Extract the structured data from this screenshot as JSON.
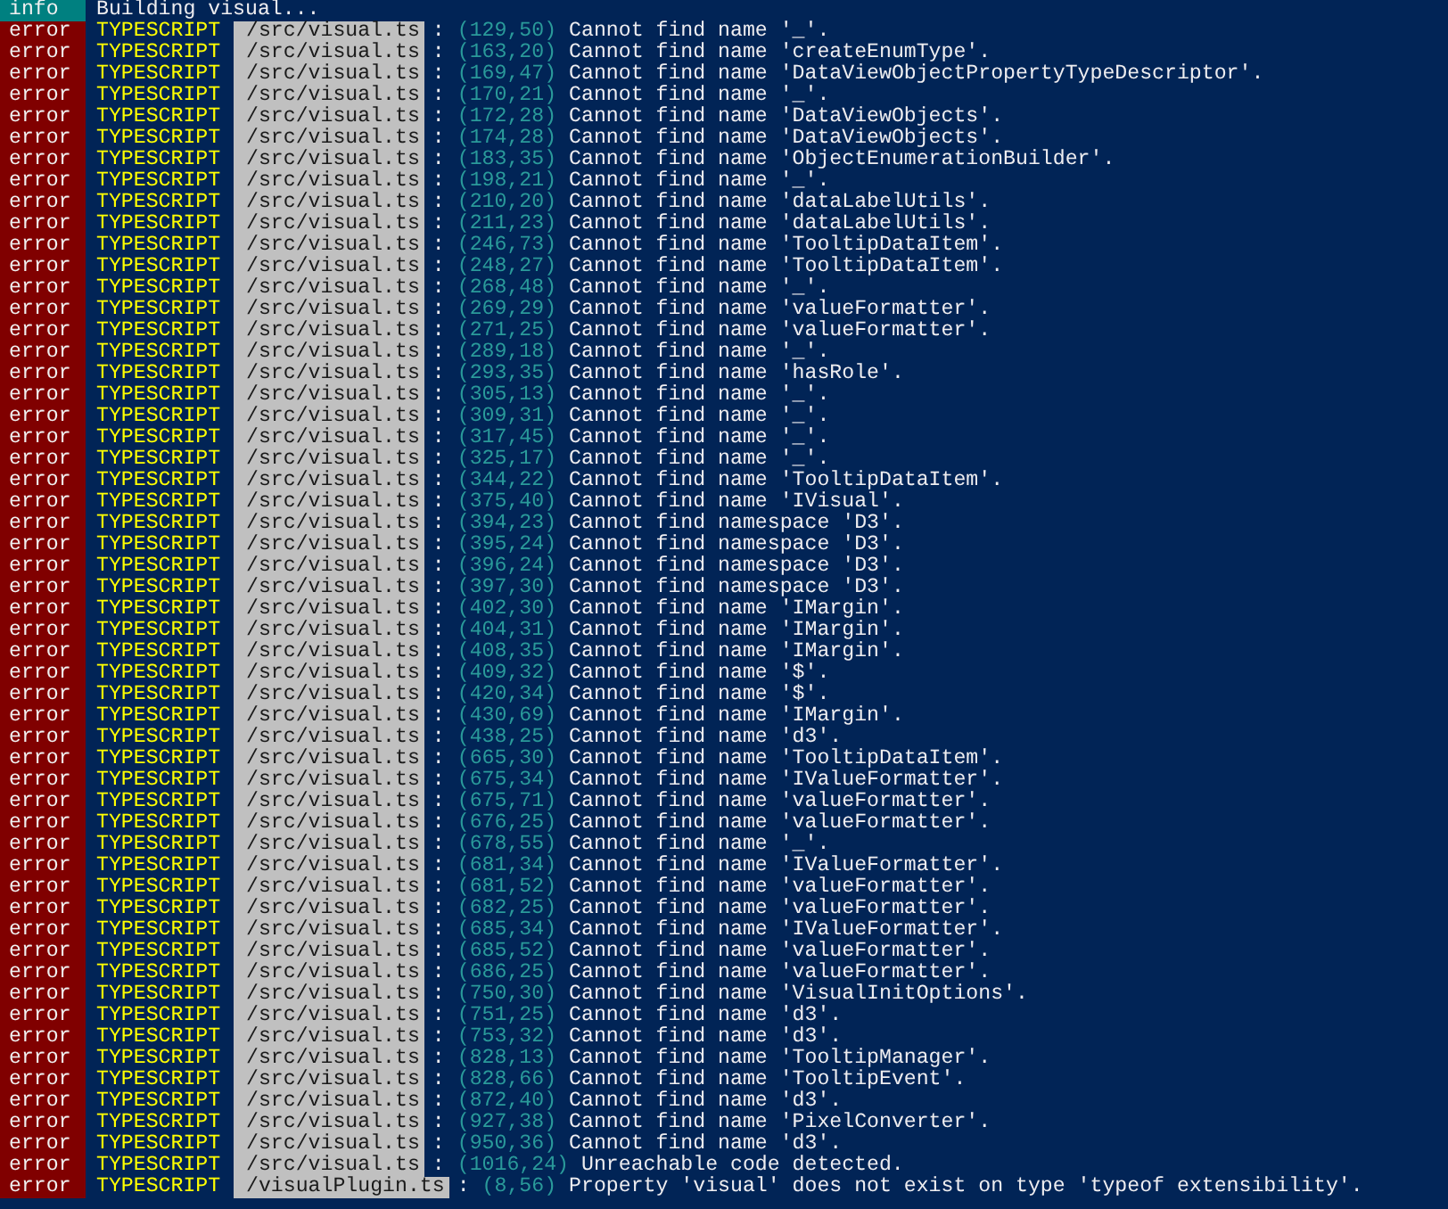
{
  "lines": [
    {
      "severity": "info",
      "message": "Building visual..."
    },
    {
      "severity": "error",
      "source": "TYPESCRIPT",
      "file": "/src/visual.ts",
      "separator": ":",
      "location": "(129,50)",
      "message": "Cannot find name '_'."
    },
    {
      "severity": "error",
      "source": "TYPESCRIPT",
      "file": "/src/visual.ts",
      "separator": ":",
      "location": "(163,20)",
      "message": "Cannot find name 'createEnumType'."
    },
    {
      "severity": "error",
      "source": "TYPESCRIPT",
      "file": "/src/visual.ts",
      "separator": ":",
      "location": "(169,47)",
      "message": "Cannot find name 'DataViewObjectPropertyTypeDescriptor'."
    },
    {
      "severity": "error",
      "source": "TYPESCRIPT",
      "file": "/src/visual.ts",
      "separator": ":",
      "location": "(170,21)",
      "message": "Cannot find name '_'."
    },
    {
      "severity": "error",
      "source": "TYPESCRIPT",
      "file": "/src/visual.ts",
      "separator": ":",
      "location": "(172,28)",
      "message": "Cannot find name 'DataViewObjects'."
    },
    {
      "severity": "error",
      "source": "TYPESCRIPT",
      "file": "/src/visual.ts",
      "separator": ":",
      "location": "(174,28)",
      "message": "Cannot find name 'DataViewObjects'."
    },
    {
      "severity": "error",
      "source": "TYPESCRIPT",
      "file": "/src/visual.ts",
      "separator": ":",
      "location": "(183,35)",
      "message": "Cannot find name 'ObjectEnumerationBuilder'."
    },
    {
      "severity": "error",
      "source": "TYPESCRIPT",
      "file": "/src/visual.ts",
      "separator": ":",
      "location": "(198,21)",
      "message": "Cannot find name '_'."
    },
    {
      "severity": "error",
      "source": "TYPESCRIPT",
      "file": "/src/visual.ts",
      "separator": ":",
      "location": "(210,20)",
      "message": "Cannot find name 'dataLabelUtils'."
    },
    {
      "severity": "error",
      "source": "TYPESCRIPT",
      "file": "/src/visual.ts",
      "separator": ":",
      "location": "(211,23)",
      "message": "Cannot find name 'dataLabelUtils'."
    },
    {
      "severity": "error",
      "source": "TYPESCRIPT",
      "file": "/src/visual.ts",
      "separator": ":",
      "location": "(246,73)",
      "message": "Cannot find name 'TooltipDataItem'."
    },
    {
      "severity": "error",
      "source": "TYPESCRIPT",
      "file": "/src/visual.ts",
      "separator": ":",
      "location": "(248,27)",
      "message": "Cannot find name 'TooltipDataItem'."
    },
    {
      "severity": "error",
      "source": "TYPESCRIPT",
      "file": "/src/visual.ts",
      "separator": ":",
      "location": "(268,48)",
      "message": "Cannot find name '_'."
    },
    {
      "severity": "error",
      "source": "TYPESCRIPT",
      "file": "/src/visual.ts",
      "separator": ":",
      "location": "(269,29)",
      "message": "Cannot find name 'valueFormatter'."
    },
    {
      "severity": "error",
      "source": "TYPESCRIPT",
      "file": "/src/visual.ts",
      "separator": ":",
      "location": "(271,25)",
      "message": "Cannot find name 'valueFormatter'."
    },
    {
      "severity": "error",
      "source": "TYPESCRIPT",
      "file": "/src/visual.ts",
      "separator": ":",
      "location": "(289,18)",
      "message": "Cannot find name '_'."
    },
    {
      "severity": "error",
      "source": "TYPESCRIPT",
      "file": "/src/visual.ts",
      "separator": ":",
      "location": "(293,35)",
      "message": "Cannot find name 'hasRole'."
    },
    {
      "severity": "error",
      "source": "TYPESCRIPT",
      "file": "/src/visual.ts",
      "separator": ":",
      "location": "(305,13)",
      "message": "Cannot find name '_'."
    },
    {
      "severity": "error",
      "source": "TYPESCRIPT",
      "file": "/src/visual.ts",
      "separator": ":",
      "location": "(309,31)",
      "message": "Cannot find name '_'."
    },
    {
      "severity": "error",
      "source": "TYPESCRIPT",
      "file": "/src/visual.ts",
      "separator": ":",
      "location": "(317,45)",
      "message": "Cannot find name '_'."
    },
    {
      "severity": "error",
      "source": "TYPESCRIPT",
      "file": "/src/visual.ts",
      "separator": ":",
      "location": "(325,17)",
      "message": "Cannot find name '_'."
    },
    {
      "severity": "error",
      "source": "TYPESCRIPT",
      "file": "/src/visual.ts",
      "separator": ":",
      "location": "(344,22)",
      "message": "Cannot find name 'TooltipDataItem'."
    },
    {
      "severity": "error",
      "source": "TYPESCRIPT",
      "file": "/src/visual.ts",
      "separator": ":",
      "location": "(375,40)",
      "message": "Cannot find name 'IVisual'."
    },
    {
      "severity": "error",
      "source": "TYPESCRIPT",
      "file": "/src/visual.ts",
      "separator": ":",
      "location": "(394,23)",
      "message": "Cannot find namespace 'D3'."
    },
    {
      "severity": "error",
      "source": "TYPESCRIPT",
      "file": "/src/visual.ts",
      "separator": ":",
      "location": "(395,24)",
      "message": "Cannot find namespace 'D3'."
    },
    {
      "severity": "error",
      "source": "TYPESCRIPT",
      "file": "/src/visual.ts",
      "separator": ":",
      "location": "(396,24)",
      "message": "Cannot find namespace 'D3'."
    },
    {
      "severity": "error",
      "source": "TYPESCRIPT",
      "file": "/src/visual.ts",
      "separator": ":",
      "location": "(397,30)",
      "message": "Cannot find namespace 'D3'."
    },
    {
      "severity": "error",
      "source": "TYPESCRIPT",
      "file": "/src/visual.ts",
      "separator": ":",
      "location": "(402,30)",
      "message": "Cannot find name 'IMargin'."
    },
    {
      "severity": "error",
      "source": "TYPESCRIPT",
      "file": "/src/visual.ts",
      "separator": ":",
      "location": "(404,31)",
      "message": "Cannot find name 'IMargin'."
    },
    {
      "severity": "error",
      "source": "TYPESCRIPT",
      "file": "/src/visual.ts",
      "separator": ":",
      "location": "(408,35)",
      "message": "Cannot find name 'IMargin'."
    },
    {
      "severity": "error",
      "source": "TYPESCRIPT",
      "file": "/src/visual.ts",
      "separator": ":",
      "location": "(409,32)",
      "message": "Cannot find name '$'."
    },
    {
      "severity": "error",
      "source": "TYPESCRIPT",
      "file": "/src/visual.ts",
      "separator": ":",
      "location": "(420,34)",
      "message": "Cannot find name '$'."
    },
    {
      "severity": "error",
      "source": "TYPESCRIPT",
      "file": "/src/visual.ts",
      "separator": ":",
      "location": "(430,69)",
      "message": "Cannot find name 'IMargin'."
    },
    {
      "severity": "error",
      "source": "TYPESCRIPT",
      "file": "/src/visual.ts",
      "separator": ":",
      "location": "(438,25)",
      "message": "Cannot find name 'd3'."
    },
    {
      "severity": "error",
      "source": "TYPESCRIPT",
      "file": "/src/visual.ts",
      "separator": ":",
      "location": "(665,30)",
      "message": "Cannot find name 'TooltipDataItem'."
    },
    {
      "severity": "error",
      "source": "TYPESCRIPT",
      "file": "/src/visual.ts",
      "separator": ":",
      "location": "(675,34)",
      "message": "Cannot find name 'IValueFormatter'."
    },
    {
      "severity": "error",
      "source": "TYPESCRIPT",
      "file": "/src/visual.ts",
      "separator": ":",
      "location": "(675,71)",
      "message": "Cannot find name 'valueFormatter'."
    },
    {
      "severity": "error",
      "source": "TYPESCRIPT",
      "file": "/src/visual.ts",
      "separator": ":",
      "location": "(676,25)",
      "message": "Cannot find name 'valueFormatter'."
    },
    {
      "severity": "error",
      "source": "TYPESCRIPT",
      "file": "/src/visual.ts",
      "separator": ":",
      "location": "(678,55)",
      "message": "Cannot find name '_'."
    },
    {
      "severity": "error",
      "source": "TYPESCRIPT",
      "file": "/src/visual.ts",
      "separator": ":",
      "location": "(681,34)",
      "message": "Cannot find name 'IValueFormatter'."
    },
    {
      "severity": "error",
      "source": "TYPESCRIPT",
      "file": "/src/visual.ts",
      "separator": ":",
      "location": "(681,52)",
      "message": "Cannot find name 'valueFormatter'."
    },
    {
      "severity": "error",
      "source": "TYPESCRIPT",
      "file": "/src/visual.ts",
      "separator": ":",
      "location": "(682,25)",
      "message": "Cannot find name 'valueFormatter'."
    },
    {
      "severity": "error",
      "source": "TYPESCRIPT",
      "file": "/src/visual.ts",
      "separator": ":",
      "location": "(685,34)",
      "message": "Cannot find name 'IValueFormatter'."
    },
    {
      "severity": "error",
      "source": "TYPESCRIPT",
      "file": "/src/visual.ts",
      "separator": ":",
      "location": "(685,52)",
      "message": "Cannot find name 'valueFormatter'."
    },
    {
      "severity": "error",
      "source": "TYPESCRIPT",
      "file": "/src/visual.ts",
      "separator": ":",
      "location": "(686,25)",
      "message": "Cannot find name 'valueFormatter'."
    },
    {
      "severity": "error",
      "source": "TYPESCRIPT",
      "file": "/src/visual.ts",
      "separator": ":",
      "location": "(750,30)",
      "message": "Cannot find name 'VisualInitOptions'."
    },
    {
      "severity": "error",
      "source": "TYPESCRIPT",
      "file": "/src/visual.ts",
      "separator": ":",
      "location": "(751,25)",
      "message": "Cannot find name 'd3'."
    },
    {
      "severity": "error",
      "source": "TYPESCRIPT",
      "file": "/src/visual.ts",
      "separator": ":",
      "location": "(753,32)",
      "message": "Cannot find name 'd3'."
    },
    {
      "severity": "error",
      "source": "TYPESCRIPT",
      "file": "/src/visual.ts",
      "separator": ":",
      "location": "(828,13)",
      "message": "Cannot find name 'TooltipManager'."
    },
    {
      "severity": "error",
      "source": "TYPESCRIPT",
      "file": "/src/visual.ts",
      "separator": ":",
      "location": "(828,66)",
      "message": "Cannot find name 'TooltipEvent'."
    },
    {
      "severity": "error",
      "source": "TYPESCRIPT",
      "file": "/src/visual.ts",
      "separator": ":",
      "location": "(872,40)",
      "message": "Cannot find name 'd3'."
    },
    {
      "severity": "error",
      "source": "TYPESCRIPT",
      "file": "/src/visual.ts",
      "separator": ":",
      "location": "(927,38)",
      "message": "Cannot find name 'PixelConverter'."
    },
    {
      "severity": "error",
      "source": "TYPESCRIPT",
      "file": "/src/visual.ts",
      "separator": ":",
      "location": "(950,36)",
      "message": "Cannot find name 'd3'."
    },
    {
      "severity": "error",
      "source": "TYPESCRIPT",
      "file": "/src/visual.ts",
      "separator": ":",
      "location": "(1016,24)",
      "message": "Unreachable code detected."
    },
    {
      "severity": "error",
      "source": "TYPESCRIPT",
      "file": "/visualPlugin.ts",
      "separator": ":",
      "location": "(8,56)",
      "message": "Property 'visual' does not exist on type 'typeof extensibility'."
    }
  ]
}
